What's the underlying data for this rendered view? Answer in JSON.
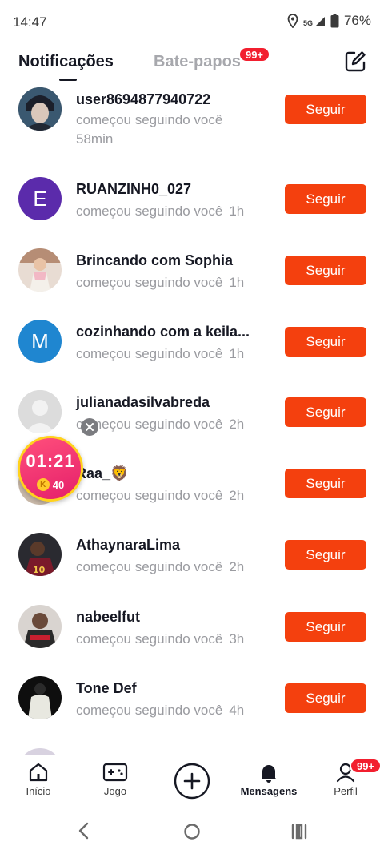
{
  "status_bar": {
    "time": "14:47",
    "battery": "76%",
    "network": "5G"
  },
  "header": {
    "tab_active": "Notificações",
    "tab_inactive": "Bate-papos",
    "chats_badge": "99+"
  },
  "notifications": [
    {
      "name": "user8694877940722",
      "action": "começou seguindo você",
      "time": "58min",
      "button": "Seguir",
      "avatar": "photo",
      "avatar_color": "#2f3b48"
    },
    {
      "name": "RUANZINH0_027",
      "action": "começou seguindo você",
      "time": "1h",
      "button": "Seguir",
      "avatar": "E",
      "avatar_color": "#5b2bab"
    },
    {
      "name": "Brincando com Sophia",
      "action": "começou seguindo você",
      "time": "1h",
      "button": "Seguir",
      "avatar": "photo",
      "avatar_color": "#c9a08a"
    },
    {
      "name": "cozinhando com a keila...",
      "action": "começou seguindo você",
      "time": "1h",
      "button": "Seguir",
      "avatar": "M",
      "avatar_color": "#1f86d0"
    },
    {
      "name": "julianadasilvabreda",
      "action": "começou seguindo você",
      "time": "2h",
      "button": "Seguir",
      "avatar": "default",
      "avatar_color": "#d8d8d8"
    },
    {
      "name": "Raa_🦁",
      "action": "começou seguindo você",
      "time": "2h",
      "button": "Seguir",
      "avatar": "photo",
      "avatar_color": "#c8b8a8"
    },
    {
      "name": "AthaynaraLima",
      "action": "começou seguindo você",
      "time": "2h",
      "button": "Seguir",
      "avatar": "photo",
      "avatar_color": "#3a2a2a"
    },
    {
      "name": "nabeelfut",
      "action": "começou seguindo você",
      "time": "3h",
      "button": "Seguir",
      "avatar": "photo",
      "avatar_color": "#5a4a4a"
    },
    {
      "name": "Tone Def",
      "action": "começou seguindo você",
      "time": "4h",
      "button": "Seguir",
      "avatar": "photo",
      "avatar_color": "#151515"
    }
  ],
  "timer_widget": {
    "time": "01:21",
    "coin_symbol": "K",
    "coins": "40"
  },
  "bottom_nav": [
    {
      "label": "Início",
      "icon": "home-icon"
    },
    {
      "label": "Jogo",
      "icon": "gamepad-icon"
    },
    {
      "label": "",
      "icon": "plus-circle-icon"
    },
    {
      "label": "Mensagens",
      "icon": "bell-icon"
    },
    {
      "label": "Perfil",
      "icon": "user-icon"
    }
  ],
  "profile_badge": "99+",
  "colors": {
    "accent": "#f4400e",
    "badge": "#f21f2f",
    "muted": "#9a9ba0"
  }
}
